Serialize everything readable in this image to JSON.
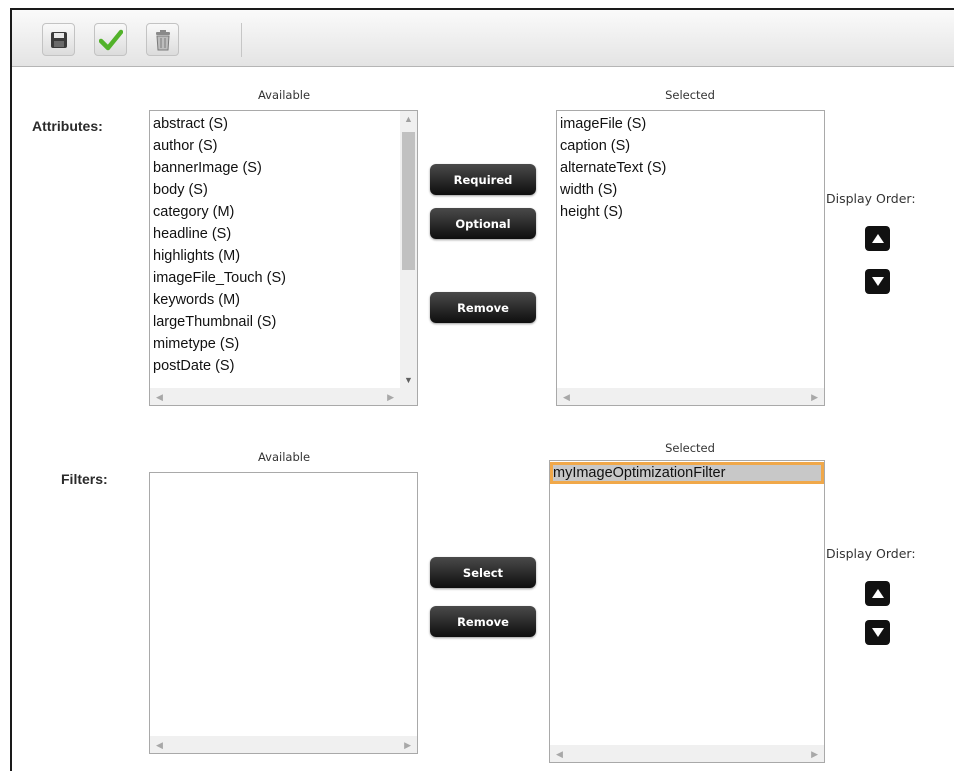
{
  "toolbar": {
    "save_icon": "floppy-disk-icon",
    "apply_icon": "green-checkmark-icon",
    "delete_icon": "trash-can-icon"
  },
  "attributes": {
    "label": "Attributes:",
    "available_title": "Available",
    "selected_title": "Selected",
    "available": [
      "abstract (S)",
      "author (S)",
      "bannerImage (S)",
      "body (S)",
      "category (M)",
      "headline (S)",
      "highlights (M)",
      "imageFile_Touch (S)",
      "keywords (M)",
      "largeThumbnail (S)",
      "mimetype (S)",
      "postDate (S)"
    ],
    "selected": [
      "imageFile (S)",
      "caption (S)",
      "alternateText (S)",
      "width (S)",
      "height (S)"
    ],
    "buttons": {
      "required": "Required",
      "optional": "Optional",
      "remove": "Remove"
    },
    "display_order_label": "Display Order:"
  },
  "filters": {
    "label": "Filters:",
    "available_title": "Available",
    "selected_title": "Selected",
    "available": [],
    "selected": [
      "myImageOptimizationFilter"
    ],
    "buttons": {
      "select": "Select",
      "remove": "Remove"
    },
    "display_order_label": "Display Order:"
  },
  "colors": {
    "highlight_outline": "#f0a84a",
    "button_bg": "#1a1a1a"
  }
}
